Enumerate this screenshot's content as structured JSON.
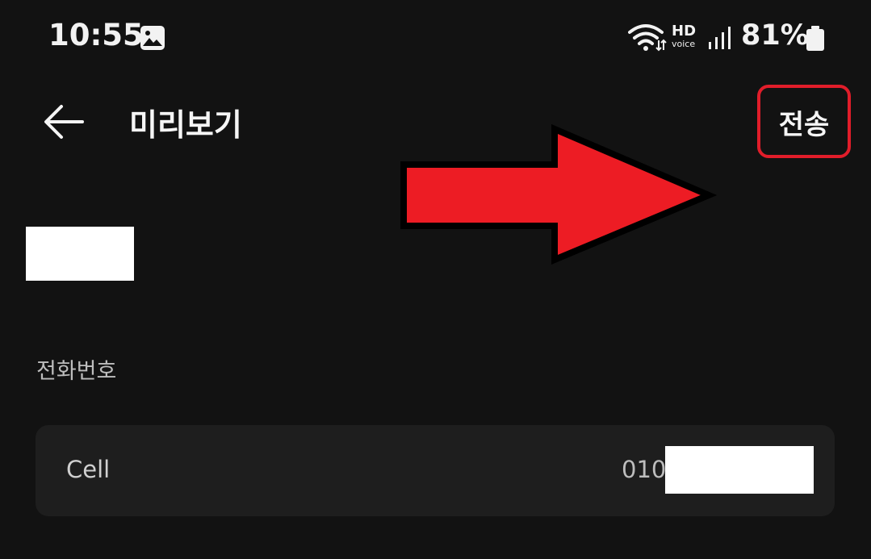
{
  "status_bar": {
    "time": "10:55",
    "hd_label": "HD",
    "voice_label": "voice",
    "battery_percent": "81%"
  },
  "app_bar": {
    "title": "미리보기",
    "send_label": "전송"
  },
  "annotation": {
    "arrow_color": "#e11d2a",
    "highlight_color": "#e11d2a"
  },
  "contact": {
    "phone_section_label": "전화번호",
    "phones": [
      {
        "type": "Cell",
        "number_prefix": "010"
      }
    ]
  }
}
